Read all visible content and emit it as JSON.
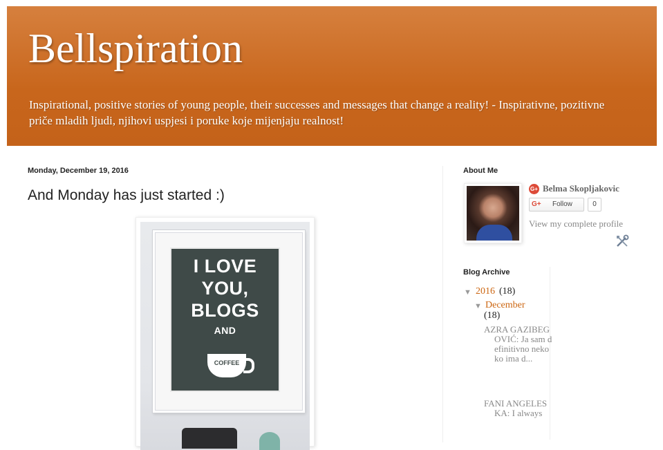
{
  "header": {
    "title": "Bellspiration",
    "description": "Inspirational, positive stories of young people, their successes and messages that change a reality! - Inspirativne, pozitivne priče mladih ljudi, njihovi uspjesi i poruke koje mijenjaju realnost!",
    "background_color": "#c8661c"
  },
  "post": {
    "date": "Monday, December 19, 2016",
    "title": "And Monday has just started :)",
    "image": {
      "poster_lines": [
        "I LOVE",
        "YOU,",
        "BLOGS",
        "AND"
      ],
      "cup_label": "COFFEE"
    }
  },
  "sidebar": {
    "about": {
      "title": "About Me",
      "name": "Belma Skopljakovic",
      "gplus_glyph": "G+",
      "follow_label": "Follow",
      "follow_count": "0",
      "view_profile": "View my complete profile",
      "tools_icon": "wrench-screwdriver-icon"
    },
    "archive": {
      "title": "Blog Archive",
      "year": {
        "toggle": "▼",
        "label": "2016",
        "count": "(18)"
      },
      "month": {
        "toggle": "▼",
        "label": "December",
        "count": "(18)"
      },
      "posts": [
        "AZRA GAZIBEGOVIĆ: Ja sam definitivno neko ko ima d...",
        "FANI ANGELESKA: I always"
      ]
    }
  },
  "colors": {
    "link_orange": "#cc6611",
    "text": "#222222",
    "muted_link": "#888888"
  }
}
